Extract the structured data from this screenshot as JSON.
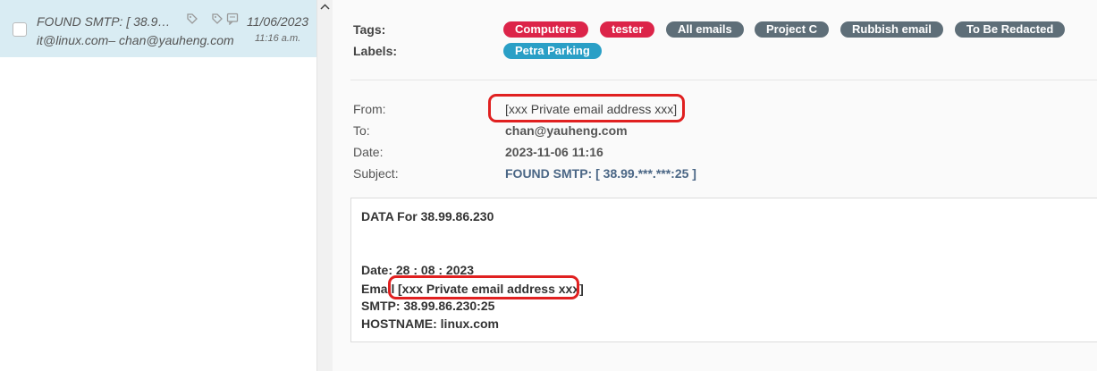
{
  "message_list": {
    "items": [
      {
        "subject": "FOUND SMTP: [ 38.9…",
        "addresses": "it@linux.com– chan@yauheng.com",
        "date": "11/06/2023",
        "time": "11:16 a.m."
      }
    ]
  },
  "detail": {
    "tags_label": "Tags:",
    "labels_label": "Labels:",
    "tags": [
      "Computers",
      "tester",
      "All emails",
      "Project C",
      "Rubbish email",
      "To Be Redacted"
    ],
    "labels": [
      "Petra Parking"
    ],
    "headers": {
      "from_label": "From:",
      "from_value": "[xxx Private email address xxx]",
      "to_label": "To:",
      "to_value": "chan@yauheng.com",
      "date_label": "Date:",
      "date_value": "2023-11-06 11:16",
      "subject_label": "Subject:",
      "subject_value": "FOUND SMTP: [ 38.99.***.***:25 ]"
    },
    "body": {
      "line1": "DATA For 38.99.86.230",
      "line2": "Date: 28 : 08 : 2023",
      "line3_prefix": "Email",
      "line3_value": "[xxx Private email address xxx]",
      "line4": "SMTP: 38.99.86.230:25",
      "line5": "HOSTNAME: linux.com"
    }
  },
  "colors": {
    "selected_row": "#d9ecf3",
    "tag_red": "#dc2449",
    "tag_gray": "#5e6e78",
    "label_teal": "#2a9fc6",
    "redaction_ring": "#e02020"
  },
  "icons": [
    "checkbox",
    "tag-icon",
    "tag-outline-icon",
    "comment-icon",
    "scroll-up-icon"
  ]
}
